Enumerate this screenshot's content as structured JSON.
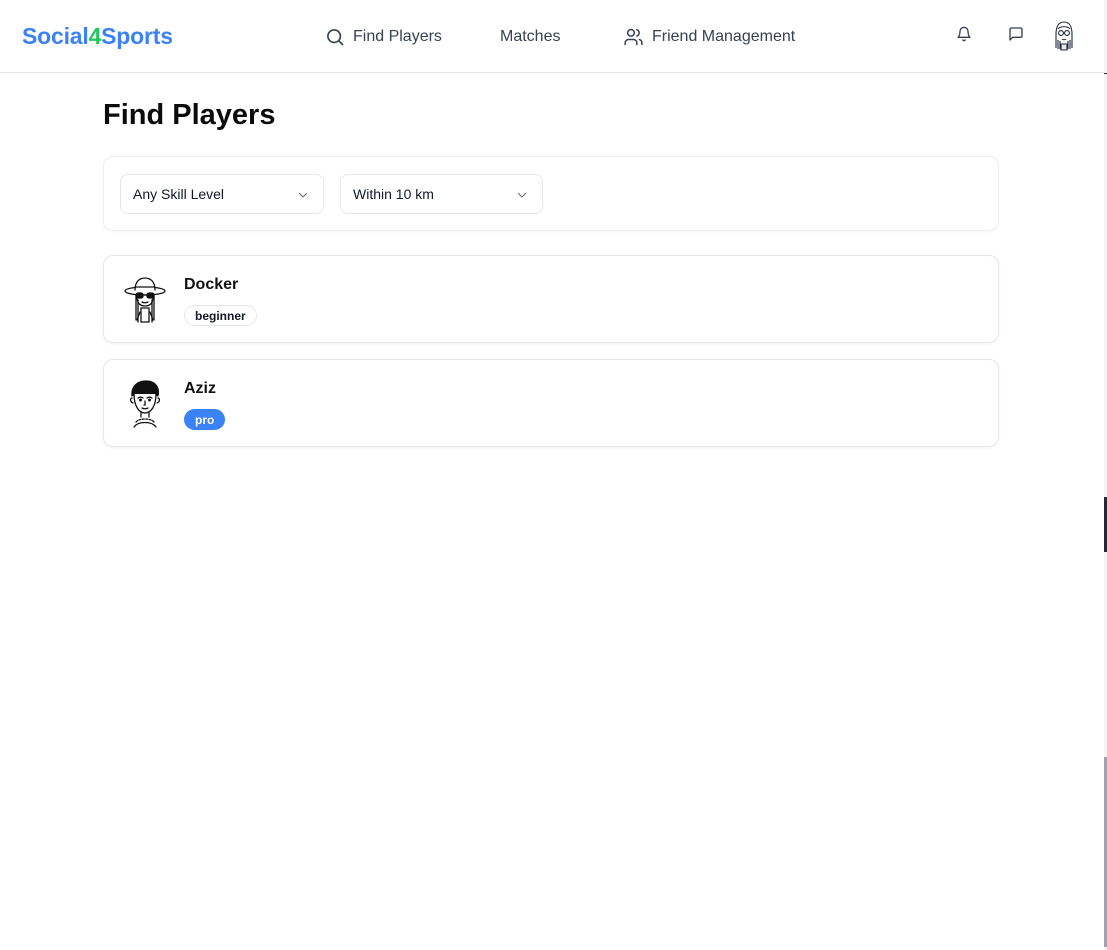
{
  "brand": {
    "part1": "Social",
    "part2": "4",
    "part3": "Sports"
  },
  "nav": {
    "find_players": "Find Players",
    "matches": "Matches",
    "friend_management": "Friend Management"
  },
  "page": {
    "title": "Find Players"
  },
  "filters": {
    "skill": "Any Skill Level",
    "distance": "Within 10 km"
  },
  "players": [
    {
      "name": "Docker",
      "level": "beginner",
      "avatar_icon": "avatar-hat-sunglasses-icon"
    },
    {
      "name": "Aziz",
      "level": "pro",
      "avatar_icon": "avatar-boy-icon"
    }
  ],
  "colors": {
    "accent": "#3b82f6",
    "brand_green": "#22c55e",
    "border": "#e5e7eb"
  },
  "icons": {
    "search": "search-icon",
    "friends": "users-icon",
    "bell": "bell-icon",
    "message": "message-icon"
  }
}
